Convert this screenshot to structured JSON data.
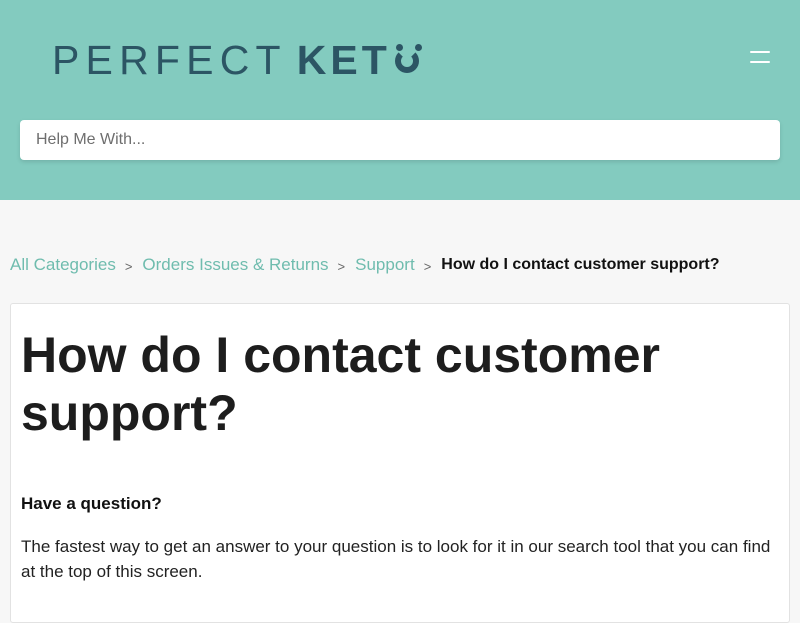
{
  "header": {
    "logo_light": "PERFECT",
    "logo_bold": "KET",
    "brand_color": "#83cbbf",
    "menu_icon": "hamburger-icon"
  },
  "search": {
    "placeholder": "Help Me With..."
  },
  "breadcrumb": {
    "items": [
      "All Categories",
      "Orders Issues & Returns",
      "Support"
    ],
    "current": "How do I contact customer support?",
    "separator": ">"
  },
  "article": {
    "title": "How do I contact customer support?",
    "subheading": "Have a question?",
    "paragraph": "The fastest way to get an answer to your question is to look for it in our search tool that you can find at the top of this screen."
  }
}
